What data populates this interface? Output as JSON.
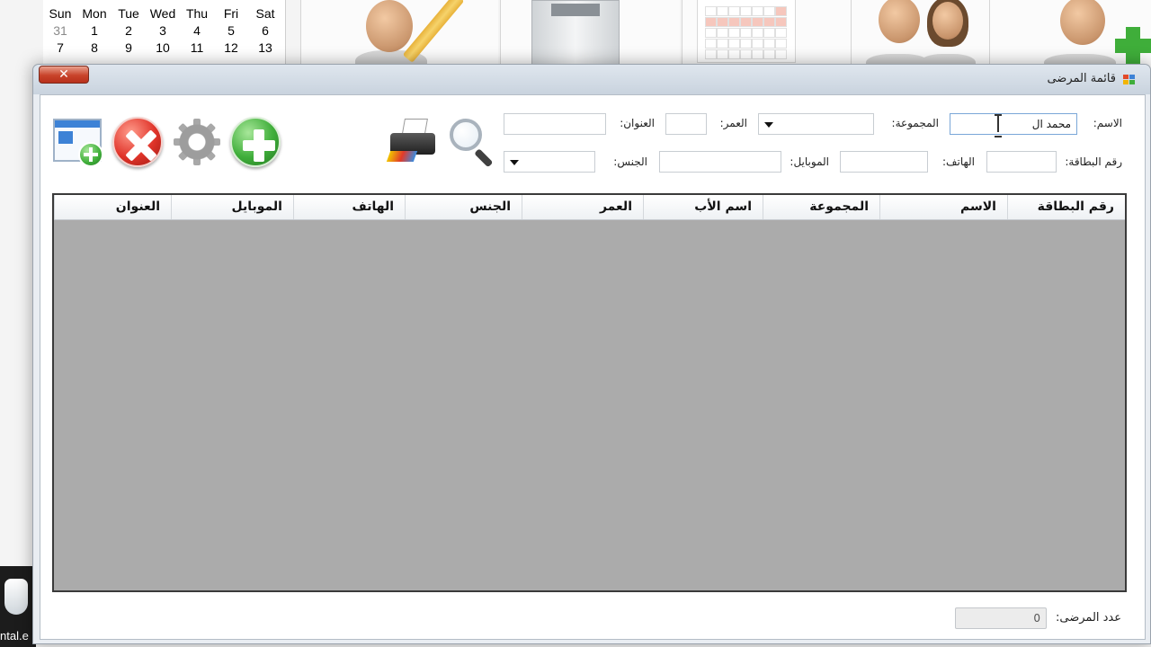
{
  "background": {
    "calendar": {
      "weekdays": [
        "Sun",
        "Mon",
        "Tue",
        "Wed",
        "Thu",
        "Fri",
        "Sat"
      ],
      "week1": [
        "31",
        "1",
        "2",
        "3",
        "4",
        "5",
        "6"
      ],
      "week2": [
        "7",
        "8",
        "9",
        "10",
        "11",
        "12",
        "13"
      ]
    },
    "taskbar_caption": "ntal.e"
  },
  "window": {
    "title": "قائمة المرضى",
    "close_label": "✕"
  },
  "toolbar": {
    "icons": [
      "new-form-icon",
      "delete-icon",
      "settings-icon",
      "add-icon",
      "print-icon",
      "search-icon"
    ]
  },
  "form": {
    "name_label": "الاسم:",
    "name_value": "محمد ال",
    "group_label": "المجموعة:",
    "group_value": "",
    "age_label": "العمر:",
    "age_value": "",
    "address_label": "العنوان:",
    "address_value": "",
    "card_label": "رقم البطاقة:",
    "card_value": "",
    "phone_label": "الهاتف:",
    "phone_value": "",
    "mobile_label": "الموبايل:",
    "mobile_value": "",
    "gender_label": "الجنس:",
    "gender_value": ""
  },
  "grid": {
    "columns": [
      "رقم البطاقة",
      "الاسم",
      "المجموعة",
      "اسم الأب",
      "العمر",
      "الجنس",
      "الهاتف",
      "الموبايل",
      "العنوان"
    ]
  },
  "footer": {
    "count_label": "عدد المرضى:",
    "count_value": "0"
  },
  "colors": {
    "grid_background": "#ababab",
    "add_green": "#3fae3a",
    "delete_red": "#e0342a",
    "close_red": "#c8432a"
  }
}
